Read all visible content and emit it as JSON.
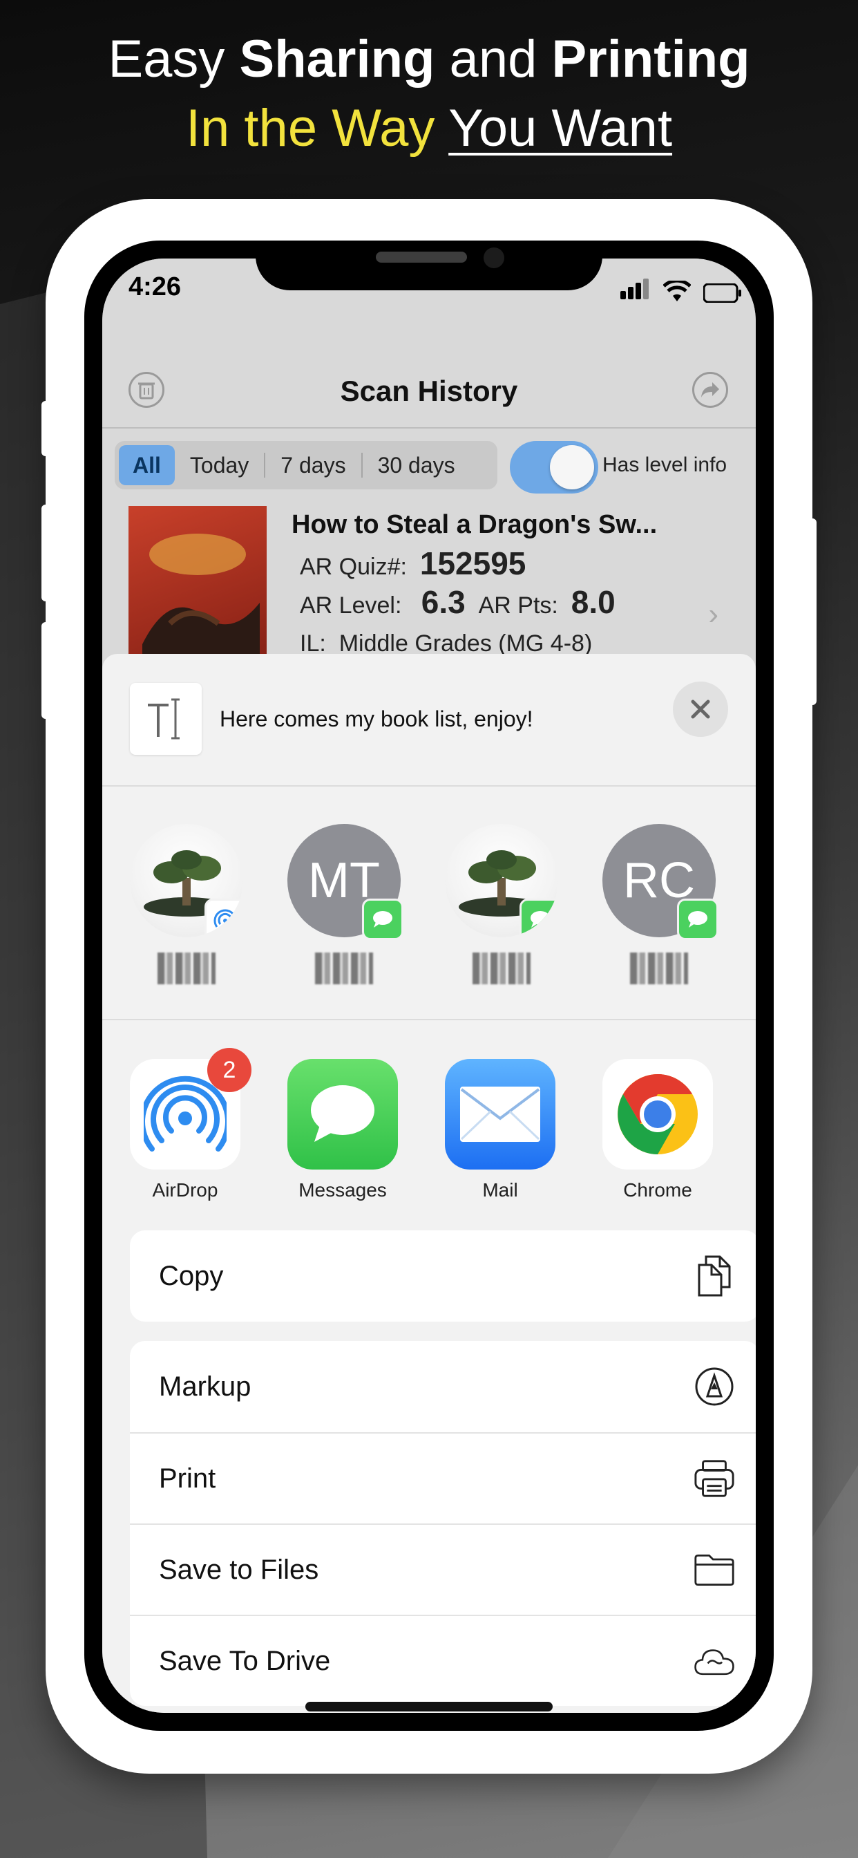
{
  "headline": {
    "line1_a": "Easy ",
    "line1_b": "Sharing",
    "line1_c": " and ",
    "line1_d": "Printing",
    "line2_a": "In the Way ",
    "line2_b": "You Want"
  },
  "colors": {
    "accent_yellow": "#f2e23d",
    "toggle_blue": "#6ea8e6",
    "messages_green": "#4bd15f",
    "badge_red": "#e8483c",
    "mail_blue": "#3a8ef3"
  },
  "status_bar": {
    "time": "4:26"
  },
  "app": {
    "nav_title": "Scan History",
    "segments": [
      "All",
      "Today",
      "7 days",
      "30 days"
    ],
    "selected_segment": "All",
    "toggle_on": true,
    "toggle_label": "Has level info",
    "book": {
      "title": "How to Steal a Dragon's Sw...",
      "quiz_label": "AR Quiz#:",
      "quiz_value": "152595",
      "level_label": "AR Level:",
      "level_value": "6.3",
      "pts_label": "AR Pts:",
      "pts_value": "8.0",
      "il_label": "IL:",
      "il_value": "Middle Grades (MG 4-8)"
    }
  },
  "share_sheet": {
    "message": "Here comes my book list, enjoy!",
    "people": [
      {
        "initials": "",
        "badge": "airdrop"
      },
      {
        "initials": "MT",
        "badge": "messages"
      },
      {
        "initials": "",
        "badge": "messages"
      },
      {
        "initials": "RC",
        "badge": "messages"
      }
    ],
    "apps": [
      {
        "label": "AirDrop",
        "badge": "2"
      },
      {
        "label": "Messages"
      },
      {
        "label": "Mail"
      },
      {
        "label": "Chrome"
      }
    ],
    "actions_group1": [
      {
        "label": "Copy",
        "icon": "copy-icon"
      }
    ],
    "actions_group2": [
      {
        "label": "Markup",
        "icon": "markup-icon"
      },
      {
        "label": "Print",
        "icon": "print-icon"
      },
      {
        "label": "Save to Files",
        "icon": "folder-icon"
      },
      {
        "label": "Save To Drive",
        "icon": "cloud-icon"
      }
    ]
  }
}
